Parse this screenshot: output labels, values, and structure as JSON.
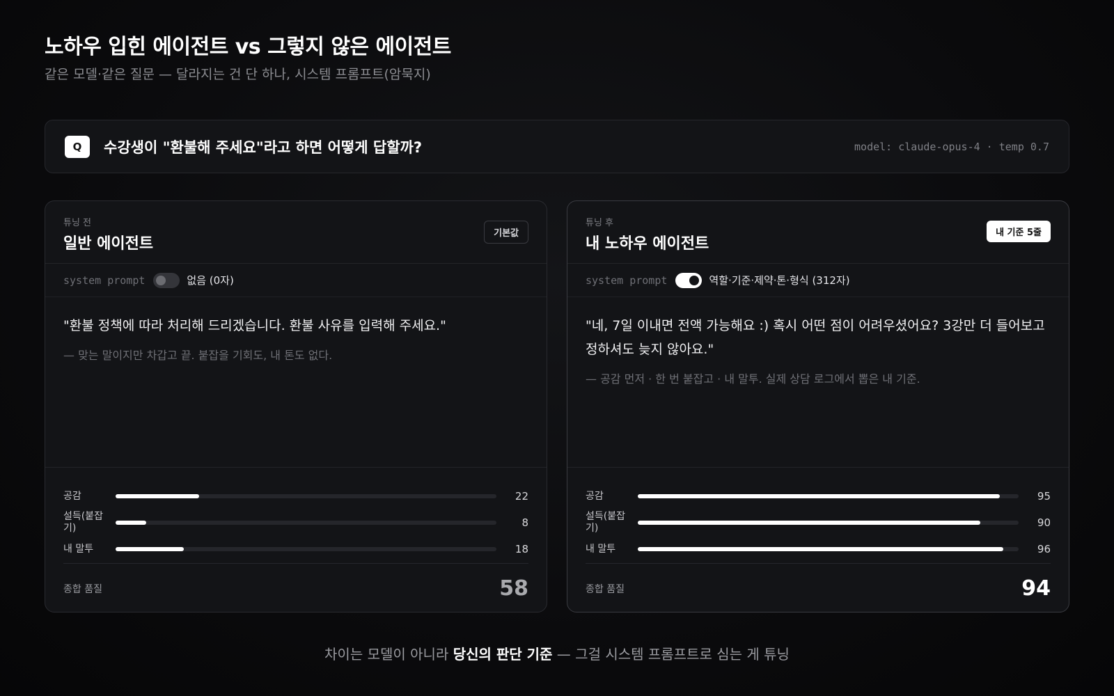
{
  "header": {
    "title": "노하우 입힌 에이전트 vs 그렇지 않은 에이전트",
    "subtitle": "같은 모델·같은 질문 — 달라지는 건 단 하나, 시스템 프롬프트(암묵지)"
  },
  "question": {
    "badge": "Q",
    "text": "수강생이 \"환불해 주세요\"라고 하면 어떻게 답할까?",
    "meta": "model: claude-opus-4 · temp 0.7"
  },
  "cards": {
    "left": {
      "tag": "튜닝 전",
      "title": "일반 에이전트",
      "badge": "기본값",
      "system_label": "system prompt",
      "system_toggle": "off",
      "system_value": "없음 (0자)",
      "quote": "\"환불 정책에 따라 처리해 드리겠습니다. 환불 사유를 입력해 주세요.\"",
      "note": "— 맞는 말이지만 차갑고 끝. 붙잡을 기회도, 내 톤도 없다.",
      "metrics": [
        {
          "label": "공감",
          "value": 22
        },
        {
          "label": "설득(붙잡기)",
          "value": 8
        },
        {
          "label": "내 말투",
          "value": 18
        }
      ],
      "total_label": "종합 품질",
      "total_value": "58"
    },
    "right": {
      "tag": "튜닝 후",
      "title": "내 노하우 에이전트",
      "badge": "내 기준 5줄",
      "system_label": "system prompt",
      "system_toggle": "on",
      "system_value": "역할·기준·제약·톤·형식 (312자)",
      "quote": "\"네, 7일 이내면 전액 가능해요 :) 혹시 어떤 점이 어려우셨어요? 3강만 더 들어보고 정하셔도 늦지 않아요.\"",
      "note": "— 공감 먼저 · 한 번 붙잡고 · 내 말투. 실제 상담 로그에서 뽑은 내 기준.",
      "metrics": [
        {
          "label": "공감",
          "value": 95
        },
        {
          "label": "설득(붙잡기)",
          "value": 90
        },
        {
          "label": "내 말투",
          "value": 96
        }
      ],
      "total_label": "종합 품질",
      "total_value": "94"
    }
  },
  "footer": {
    "pre": "차이는 모델이 아니라 ",
    "bold": "당신의 판단 기준",
    "post": " — 그걸 시스템 프롬프트로 심는 게 튜닝"
  }
}
